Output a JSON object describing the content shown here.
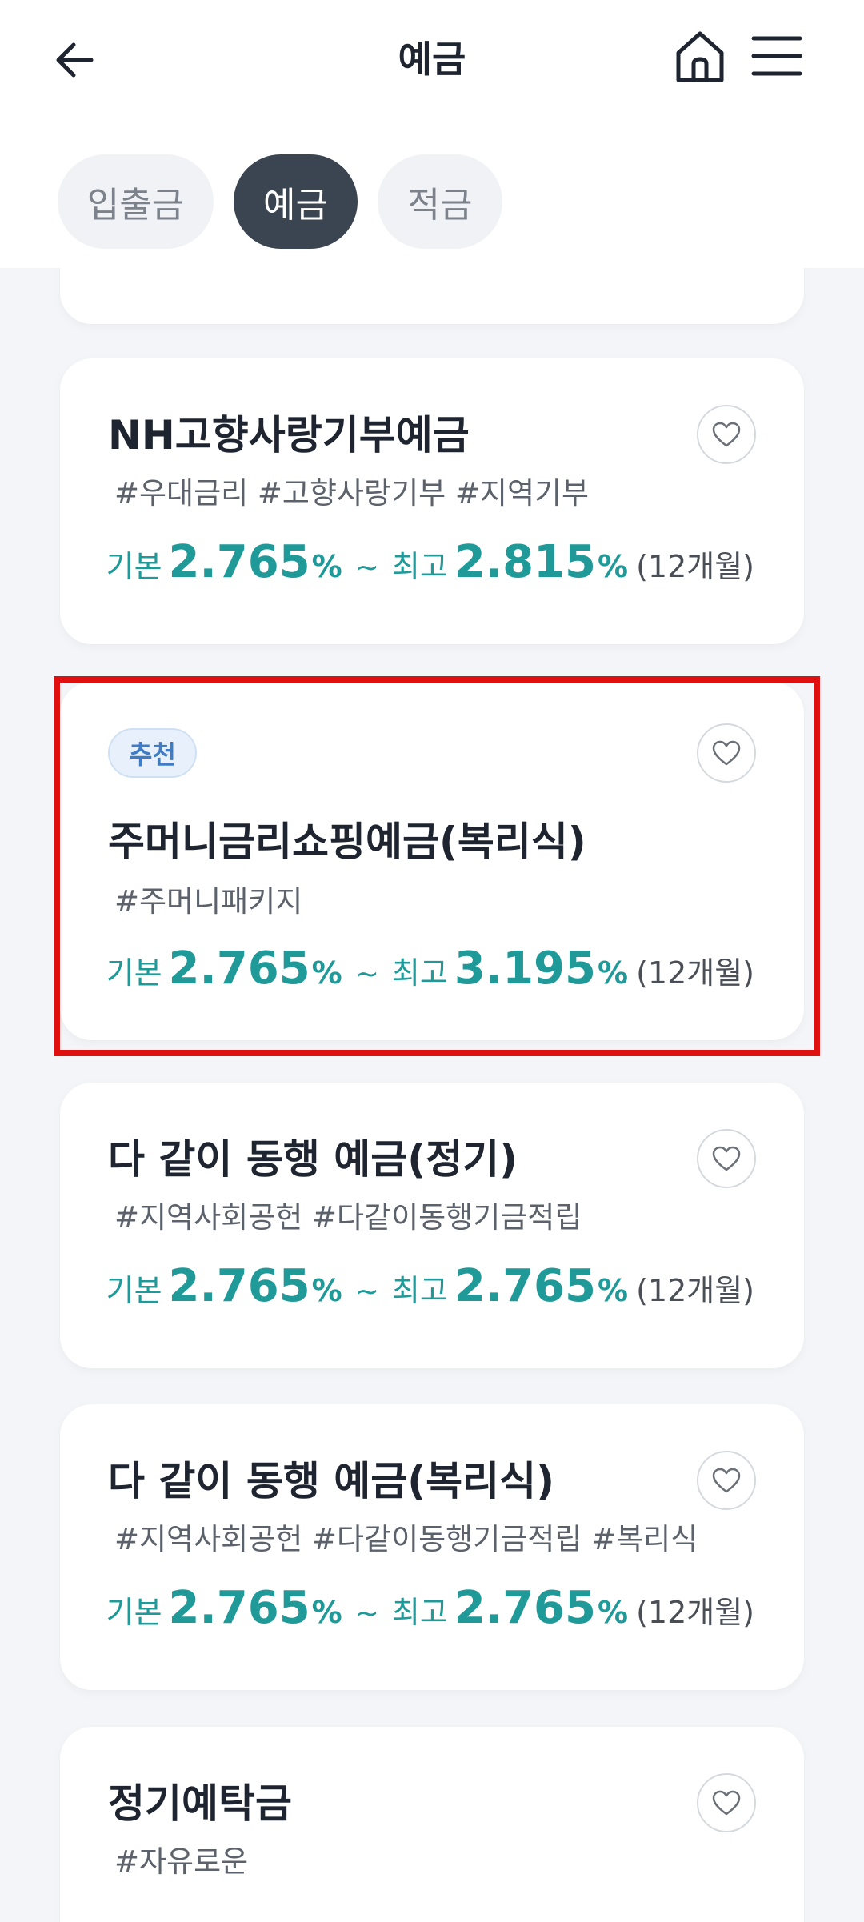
{
  "header": {
    "title": "예금",
    "back_icon": "back-arrow-icon",
    "home_icon": "home-icon",
    "menu_icon": "hamburger-menu-icon"
  },
  "tabs": [
    {
      "label": "입출금",
      "active": false
    },
    {
      "label": "예금",
      "active": true
    },
    {
      "label": "적금",
      "active": false
    }
  ],
  "products": [
    {
      "name": "NH고향사랑기부예금",
      "tags": "#우대금리  #고향사랑기부  #지역기부",
      "base_label": "기본",
      "base_rate": "2.765",
      "max_label": "최고",
      "max_rate": "2.815",
      "term": "(12개월)"
    },
    {
      "badge": "추천",
      "name": "주머니금리쇼핑예금(복리식)",
      "tags": "#주머니패키지",
      "base_label": "기본",
      "base_rate": "2.765",
      "max_label": "최고",
      "max_rate": "3.195",
      "term": "(12개월)"
    },
    {
      "name": "다 같이 동행 예금(정기)",
      "tags": "#지역사회공헌  #다같이동행기금적립",
      "base_label": "기본",
      "base_rate": "2.765",
      "max_label": "최고",
      "max_rate": "2.765",
      "term": "(12개월)"
    },
    {
      "name": "다 같이 동행 예금(복리식)",
      "tags": "#지역사회공헌  #다같이동행기금적립  #복리식",
      "base_label": "기본",
      "base_rate": "2.765",
      "max_label": "최고",
      "max_rate": "2.765",
      "term": "(12개월)"
    },
    {
      "name": "정기예탁금",
      "tags": "#자유로운"
    }
  ],
  "colors": {
    "accent": "#1f9a99",
    "active_tab": "#3b4551",
    "highlight": "#e01010",
    "badge_text": "#3f7cc4"
  }
}
